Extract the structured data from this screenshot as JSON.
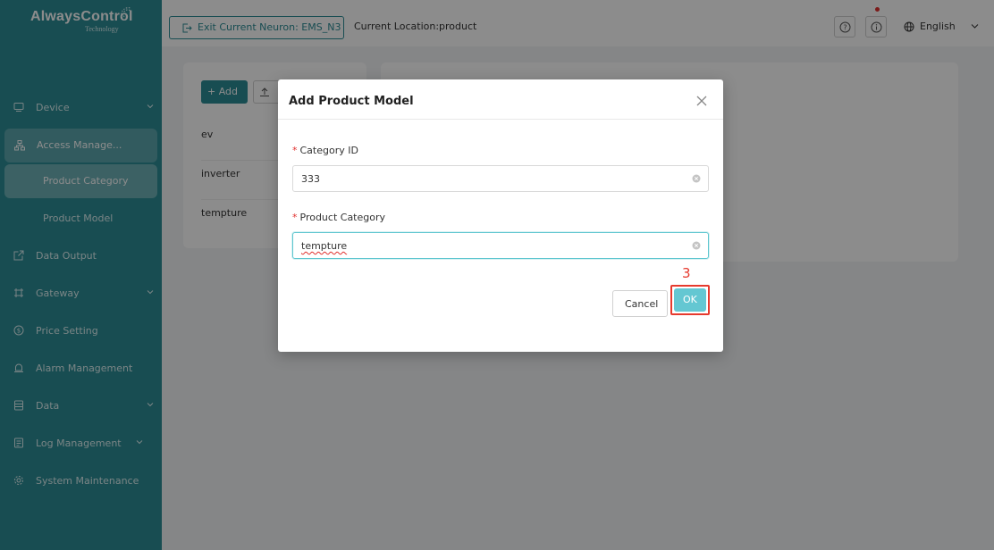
{
  "app": {
    "logo_text": "AlwaysControl",
    "logo_subtext": "Technology"
  },
  "sidebar": {
    "items": [
      {
        "label": "Device",
        "icon": "monitor-icon",
        "has_children": true
      },
      {
        "label": "Access Manage...",
        "icon": "org-chart-icon",
        "has_children": false
      },
      {
        "label": "Product Category",
        "icon": "",
        "has_children": false
      },
      {
        "label": "Product Model",
        "icon": "",
        "has_children": false
      },
      {
        "label": "Data Output",
        "icon": "export-icon",
        "has_children": false
      },
      {
        "label": "Gateway",
        "icon": "gateway-icon",
        "has_children": true
      },
      {
        "label": "Price Setting",
        "icon": "coin-icon",
        "has_children": false
      },
      {
        "label": "Alarm Management",
        "icon": "alarm-bell-icon",
        "has_children": false
      },
      {
        "label": "Data",
        "icon": "database-icon",
        "has_children": true
      },
      {
        "label": "Log Management",
        "icon": "log-file-icon",
        "has_children": true
      },
      {
        "label": "System Maintenance",
        "icon": "gear-icon",
        "has_children": false
      }
    ]
  },
  "header": {
    "exit_button_label": "Exit Current Neuron: EMS_N3",
    "location_text": "Current Location:product",
    "language_label": "English"
  },
  "content": {
    "add_button_label": "+ Add",
    "categories": [
      "ev",
      "inverter",
      "tempture"
    ]
  },
  "modal": {
    "title": "Add Product Model",
    "fields": [
      {
        "label": "Category ID",
        "required_mark": "*",
        "value": "333"
      },
      {
        "label": "Product Category",
        "required_mark": "*",
        "value": "tempture"
      }
    ],
    "cancel_label": "Cancel",
    "ok_label": "OK",
    "step_annotation": "3"
  },
  "colors": {
    "sidebar_bg": "#2d8c95",
    "accent": "#2d8c95",
    "ok_button": "#64c7d2",
    "highlight_red": "#e63a2e"
  }
}
